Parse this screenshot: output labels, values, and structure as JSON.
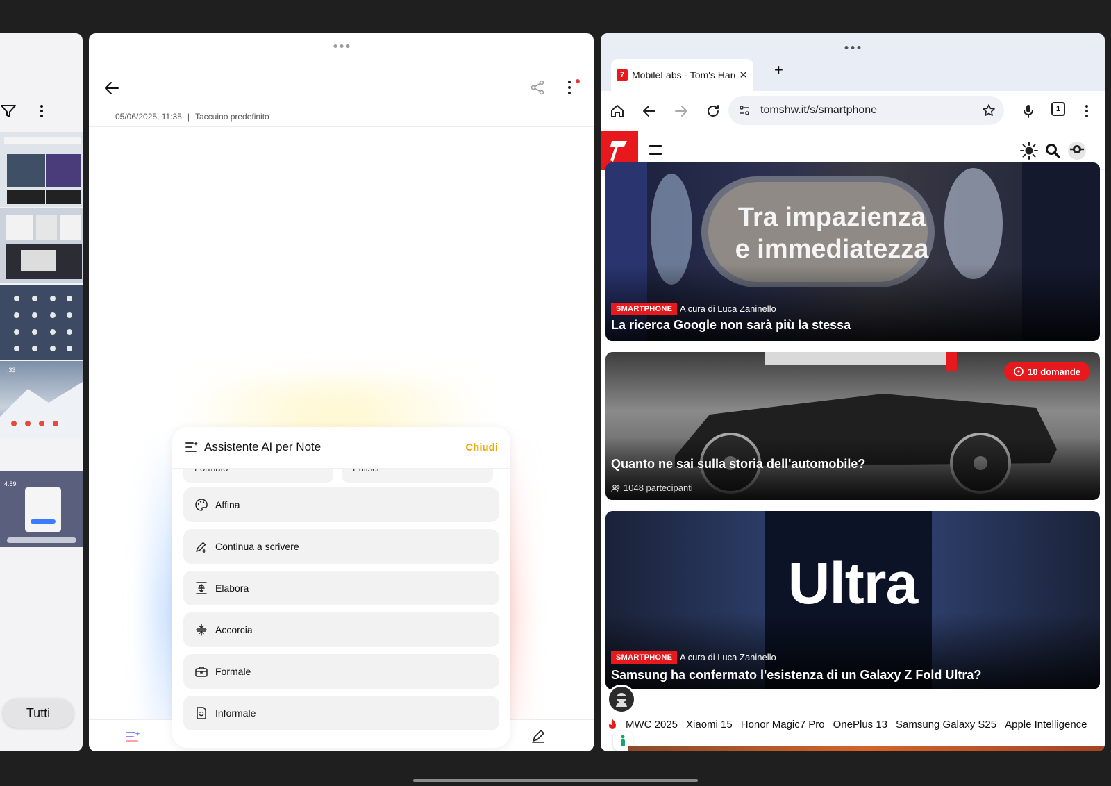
{
  "notes": {
    "meta_date": "05/06/2025, 11:35",
    "meta_separator": "|",
    "meta_notebook": "Taccuino predefinito",
    "ai_panel": {
      "title": "Assistente AI per Note",
      "close_label": "Chiudi",
      "partial_options": [
        "Formato",
        "Pulisci"
      ],
      "options": [
        {
          "label": "Affina",
          "icon": "palette-icon"
        },
        {
          "label": "Continua a scrivere",
          "icon": "pen-plus-icon"
        },
        {
          "label": "Elabora",
          "icon": "expand-lines-icon"
        },
        {
          "label": "Accorcia",
          "icon": "shorten-lines-icon"
        },
        {
          "label": "Formale",
          "icon": "briefcase-icon"
        },
        {
          "label": "Informale",
          "icon": "smile-doc-icon"
        }
      ]
    }
  },
  "gallery": {
    "tutti_label": "Tutti",
    "thumb_time_1": ":33",
    "thumb_time_2": "4:59"
  },
  "browser": {
    "tab_title": "MobileLabs - Tom's Hardwa",
    "favicon_letter": "7",
    "url": "tomshw.it/s/smartphone",
    "tab_count": "1",
    "cards": [
      {
        "image_text_line1": "Tra impazienza",
        "image_text_line2": "e immediatezza",
        "badge": "SMARTPHONE",
        "author": "A cura di Luca Zaninello",
        "title": "La ricerca Google non sarà più la stessa"
      },
      {
        "quiz_label": "10 domande",
        "title": "Quanto ne sai sulla storia dell'automobile?",
        "participants": "1048 partecipanti"
      },
      {
        "image_text": "Ultra",
        "badge": "SMARTPHONE",
        "author": "A cura di Luca Zaninello",
        "title": "Samsung ha confermato l'esistenza di un Galaxy Z Fold Ultra?"
      }
    ],
    "trending": [
      "MWC 2025",
      "Xiaomi 15",
      "Honor Magic7 Pro",
      "OnePlus 13",
      "Samsung Galaxy S25",
      "Apple Intelligence"
    ]
  },
  "colors": {
    "accent_red": "#e8191c",
    "chiudi_yellow": "#f0a800",
    "tab_strip": "#e9edf6"
  }
}
